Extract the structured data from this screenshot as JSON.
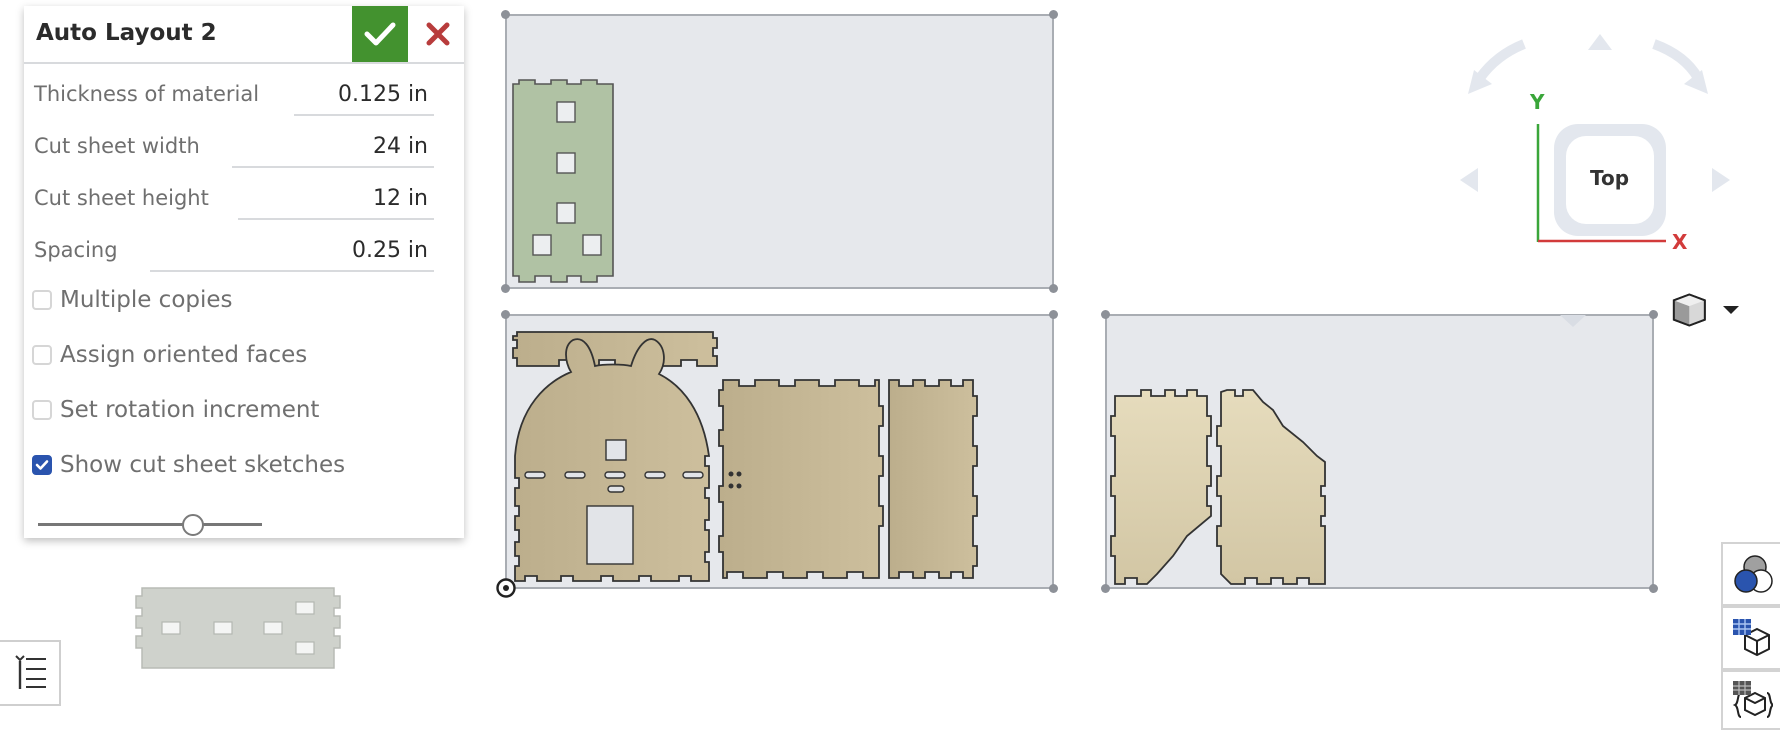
{
  "panel": {
    "title": "Auto Layout 2",
    "ok_label": "Accept",
    "cancel_label": "Cancel",
    "fields": [
      {
        "label": "Thickness of material",
        "value": "0.125 in"
      },
      {
        "label": "Cut sheet width",
        "value": "24 in"
      },
      {
        "label": "Cut sheet height",
        "value": "12 in"
      },
      {
        "label": "Spacing",
        "value": "0.25 in"
      }
    ],
    "checkboxes": [
      {
        "label": "Multiple copies",
        "checked": false
      },
      {
        "label": "Assign oriented faces",
        "checked": false
      },
      {
        "label": "Set rotation increment",
        "checked": false
      },
      {
        "label": "Show cut sheet sketches",
        "checked": true
      }
    ],
    "slider_value": 0.69
  },
  "view_cube": {
    "face_label": "Top",
    "x_axis": "X",
    "y_axis": "Y",
    "x_color": "#d23b3b",
    "y_color": "#3aa63a"
  },
  "colors": {
    "accept": "#43922f",
    "cancel": "#b83c3c",
    "checkbox_on": "#2a54ae",
    "sheet_fill": "#e6e8ec",
    "part_tan": "#c4b793",
    "part_green": "#b0c2a4",
    "part_gray": "#cfd2cc"
  },
  "icons": {
    "accept": "checkmark-icon",
    "cancel": "close-icon",
    "view_mode": "cube-shaded-icon",
    "appearances": "appearance-circles-icon",
    "bom": "bom-table-cube-icon",
    "variables": "variable-table-cube-icon",
    "list": "feature-list-icon"
  }
}
